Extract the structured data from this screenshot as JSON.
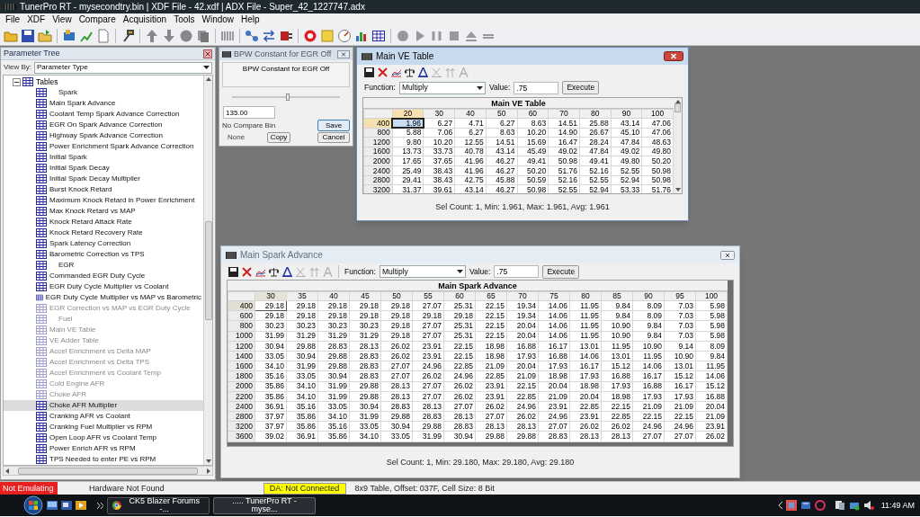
{
  "window": {
    "title": "TunerPro RT - mysecondtry.bin | XDF File - 42.xdf | ADX File - Super_42_1227747.adx"
  },
  "menu": [
    "File",
    "XDF",
    "View",
    "Compare",
    "Acquisition",
    "Tools",
    "Window",
    "Help"
  ],
  "parameter_tree": {
    "title": "Parameter Tree",
    "view_by_label": "View By:",
    "view_by": "Parameter Type",
    "root": {
      "label": "Tables",
      "expanded": true,
      "children": [
        {
          "label": "Spark",
          "kind": "heading",
          "disabled": false,
          "selected": false
        },
        {
          "label": "Main Spark Advance",
          "kind": "table",
          "disabled": false,
          "selected": false
        },
        {
          "label": "Coolant Temp Spark Advance Correction",
          "kind": "table",
          "disabled": false,
          "selected": false
        },
        {
          "label": "EGR On Spark Advance Correction",
          "kind": "table",
          "disabled": false,
          "selected": false
        },
        {
          "label": "Highway Spark Advance Correction",
          "kind": "table",
          "disabled": false,
          "selected": false
        },
        {
          "label": "Power Enrichment Spark Advance Correction",
          "kind": "table",
          "disabled": false,
          "selected": false
        },
        {
          "label": "Initial Spark",
          "kind": "table",
          "disabled": false,
          "selected": false
        },
        {
          "label": "Initial Spark Decay",
          "kind": "table",
          "disabled": false,
          "selected": false
        },
        {
          "label": "Initial Spark Decay Multiplier",
          "kind": "table",
          "disabled": false,
          "selected": false
        },
        {
          "label": "Burst Knock Retard",
          "kind": "table",
          "disabled": false,
          "selected": false
        },
        {
          "label": "Maximum Knock Retard in Power Enrichment",
          "kind": "table",
          "disabled": false,
          "selected": false
        },
        {
          "label": "Max Knock Retard vs MAP",
          "kind": "table",
          "disabled": false,
          "selected": false
        },
        {
          "label": "Knock Retard Attack Rate",
          "kind": "table",
          "disabled": false,
          "selected": false
        },
        {
          "label": "Knock Retard Recovery Rate",
          "kind": "table",
          "disabled": false,
          "selected": false
        },
        {
          "label": "Spark Latency Correction",
          "kind": "table",
          "disabled": false,
          "selected": false
        },
        {
          "label": "Barometric Correction vs TPS",
          "kind": "table",
          "disabled": false,
          "selected": false
        },
        {
          "label": "EGR",
          "kind": "heading",
          "disabled": false,
          "selected": false
        },
        {
          "label": "Commanded EGR Duty Cycle",
          "kind": "table",
          "disabled": false,
          "selected": false
        },
        {
          "label": "EGR Duty Cycle Multiplier vs Coolant",
          "kind": "table",
          "disabled": false,
          "selected": false
        },
        {
          "label": "EGR Duty Cycle Multiplier vs MAP vs Barometric",
          "kind": "table",
          "disabled": false,
          "selected": false
        },
        {
          "label": "EGR Correction vs MAP vs EGR Duty Cycle",
          "kind": "table",
          "disabled": true,
          "selected": false
        },
        {
          "label": "Fuel",
          "kind": "heading",
          "disabled": true,
          "selected": false
        },
        {
          "label": "Main VE Table",
          "kind": "table",
          "disabled": true,
          "selected": false
        },
        {
          "label": "VE Adder Table",
          "kind": "table",
          "disabled": true,
          "selected": false
        },
        {
          "label": "Accel Enrichment vs Delta MAP",
          "kind": "table",
          "disabled": true,
          "selected": false
        },
        {
          "label": "Accel Enrichment vs Delta TPS",
          "kind": "table",
          "disabled": true,
          "selected": false
        },
        {
          "label": "Accel Enrichment vs Coolant Temp",
          "kind": "table",
          "disabled": true,
          "selected": false
        },
        {
          "label": "Cold Engine AFR",
          "kind": "table",
          "disabled": true,
          "selected": false
        },
        {
          "label": "Choke AFR",
          "kind": "table",
          "disabled": true,
          "selected": false
        },
        {
          "label": "Choke AFR Multiplier",
          "kind": "table",
          "disabled": false,
          "selected": true
        },
        {
          "label": "Cranking AFR vs Coolant",
          "kind": "table",
          "disabled": false,
          "selected": false
        },
        {
          "label": "Cranking Fuel Multiplier vs RPM",
          "kind": "table",
          "disabled": false,
          "selected": false
        },
        {
          "label": "Open Loop AFR vs Coolant Temp",
          "kind": "table",
          "disabled": false,
          "selected": false
        },
        {
          "label": "Power Enrich AFR vs RPM",
          "kind": "table",
          "disabled": false,
          "selected": false
        },
        {
          "label": "TPS Needed to enter PE vs RPM",
          "kind": "table",
          "disabled": false,
          "selected": false
        }
      ]
    }
  },
  "constant_window": {
    "title": "BPW Constant for EGR Off",
    "description": "BPW Constant for EGR Off",
    "level": 0.52,
    "value": "135.00",
    "compare_label": "No Compare Bin",
    "save": "Save",
    "compare_value": "None",
    "copy": "Copy",
    "cancel": "Cancel"
  },
  "table_windows": [
    {
      "kind": "ve",
      "title": "Main VE Table",
      "active": true,
      "function_label": "Function:",
      "function": "Multiply",
      "value_label": "Value:",
      "value": ".75",
      "execute": "Execute",
      "table_title": "Main VE Table",
      "columns": [
        {
          "label": "20",
          "selected": true
        },
        {
          "label": "30",
          "selected": false
        },
        {
          "label": "40",
          "selected": false
        },
        {
          "label": "50",
          "selected": false
        },
        {
          "label": "60",
          "selected": false
        },
        {
          "label": "70",
          "selected": false
        },
        {
          "label": "80",
          "selected": false
        },
        {
          "label": "90",
          "selected": false
        },
        {
          "label": "100",
          "selected": false
        }
      ],
      "rows": [
        {
          "label": "400",
          "selected": true,
          "cells": [
            "1.96",
            "6.27",
            "4.71",
            "6.27",
            "8.63",
            "14.51",
            "25.88",
            "43.14",
            "47.06"
          ]
        },
        {
          "label": "800",
          "selected": false,
          "cells": [
            "5.88",
            "7.06",
            "6.27",
            "8.63",
            "10.20",
            "14.90",
            "26.67",
            "45.10",
            "47.06"
          ]
        },
        {
          "label": "1200",
          "selected": false,
          "cells": [
            "9.80",
            "10.20",
            "12.55",
            "14.51",
            "15.69",
            "16.47",
            "28.24",
            "47.84",
            "48.63"
          ]
        },
        {
          "label": "1600",
          "selected": false,
          "cells": [
            "13.73",
            "33.73",
            "40.78",
            "43.14",
            "45.49",
            "49.02",
            "47.84",
            "49.02",
            "49.80"
          ]
        },
        {
          "label": "2000",
          "selected": false,
          "cells": [
            "17.65",
            "37.65",
            "41.96",
            "46.27",
            "49.41",
            "50.98",
            "49.41",
            "49.80",
            "50.20"
          ]
        },
        {
          "label": "2400",
          "selected": false,
          "cells": [
            "25.49",
            "38.43",
            "41.96",
            "46.27",
            "50.20",
            "51.76",
            "52.16",
            "52.55",
            "50.98"
          ]
        },
        {
          "label": "2800",
          "selected": false,
          "cells": [
            "29.41",
            "38.43",
            "42.75",
            "45.88",
            "50.59",
            "52.16",
            "52.55",
            "52.94",
            "50.98"
          ]
        },
        {
          "label": "3200",
          "selected": false,
          "cells": [
            "31.37",
            "39.61",
            "43.14",
            "46.27",
            "50.98",
            "52.55",
            "52.94",
            "53.33",
            "51.76"
          ]
        }
      ],
      "status": "Sel Count: 1, Min: 1.961, Max: 1.961, Avg: 1.961"
    },
    {
      "kind": "spark",
      "title": "Main Spark Advance",
      "active": false,
      "function_label": "Function:",
      "function": "Multiply",
      "value_label": "Value:",
      "value": ".75",
      "execute": "Execute",
      "table_title": "Main Spark Advance",
      "columns": [
        {
          "label": "30",
          "selected": true
        },
        {
          "label": "35",
          "selected": false
        },
        {
          "label": "40",
          "selected": false
        },
        {
          "label": "45",
          "selected": false
        },
        {
          "label": "50",
          "selected": false
        },
        {
          "label": "55",
          "selected": false
        },
        {
          "label": "60",
          "selected": false
        },
        {
          "label": "65",
          "selected": false
        },
        {
          "label": "70",
          "selected": false
        },
        {
          "label": "75",
          "selected": false
        },
        {
          "label": "80",
          "selected": false
        },
        {
          "label": "85",
          "selected": false
        },
        {
          "label": "90",
          "selected": false
        },
        {
          "label": "95",
          "selected": false
        },
        {
          "label": "100",
          "selected": false
        }
      ],
      "rows": [
        {
          "label": "400",
          "selected": true,
          "cells": [
            "29.18",
            "29.18",
            "29.18",
            "29.18",
            "29.18",
            "27.07",
            "25.31",
            "22.15",
            "19.34",
            "14.06",
            "11.95",
            "9.84",
            "8.09",
            "7.03",
            "5.98"
          ]
        },
        {
          "label": "600",
          "selected": false,
          "cells": [
            "29.18",
            "29.18",
            "29.18",
            "29.18",
            "29.18",
            "29.18",
            "29.18",
            "22.15",
            "19.34",
            "14.06",
            "11.95",
            "9.84",
            "8.09",
            "7.03",
            "5.98"
          ]
        },
        {
          "label": "800",
          "selected": false,
          "cells": [
            "30.23",
            "30.23",
            "30.23",
            "30.23",
            "29.18",
            "27.07",
            "25.31",
            "22.15",
            "20.04",
            "14.06",
            "11.95",
            "10.90",
            "9.84",
            "7.03",
            "5.98"
          ]
        },
        {
          "label": "1000",
          "selected": false,
          "cells": [
            "31.99",
            "31.29",
            "31.29",
            "31.29",
            "29.18",
            "27.07",
            "25.31",
            "22.15",
            "20.04",
            "14.06",
            "11.95",
            "10.90",
            "9.84",
            "7.03",
            "5.98"
          ]
        },
        {
          "label": "1200",
          "selected": false,
          "cells": [
            "30.94",
            "29.88",
            "28.83",
            "28.13",
            "26.02",
            "23.91",
            "22.15",
            "18.98",
            "16.88",
            "16.17",
            "13.01",
            "11.95",
            "10.90",
            "9.14",
            "8.09"
          ]
        },
        {
          "label": "1400",
          "selected": false,
          "cells": [
            "33.05",
            "30.94",
            "29.88",
            "28.83",
            "26.02",
            "23.91",
            "22.15",
            "18.98",
            "17.93",
            "16.88",
            "14.06",
            "13.01",
            "11.95",
            "10.90",
            "9.84"
          ]
        },
        {
          "label": "1600",
          "selected": false,
          "cells": [
            "34.10",
            "31.99",
            "29.88",
            "28.83",
            "27.07",
            "24.96",
            "22.85",
            "21.09",
            "20.04",
            "17.93",
            "16.17",
            "15.12",
            "14.06",
            "13.01",
            "11.95"
          ]
        },
        {
          "label": "1800",
          "selected": false,
          "cells": [
            "35.16",
            "33.05",
            "30.94",
            "28.83",
            "27.07",
            "26.02",
            "24.96",
            "22.85",
            "21.09",
            "18.98",
            "17.93",
            "16.88",
            "16.17",
            "15.12",
            "14.06"
          ]
        },
        {
          "label": "2000",
          "selected": false,
          "cells": [
            "35.86",
            "34.10",
            "31.99",
            "29.88",
            "28.13",
            "27.07",
            "26.02",
            "23.91",
            "22.15",
            "20.04",
            "18.98",
            "17.93",
            "16.88",
            "16.17",
            "15.12"
          ]
        },
        {
          "label": "2200",
          "selected": false,
          "cells": [
            "35.86",
            "34.10",
            "31.99",
            "29.88",
            "28.13",
            "27.07",
            "26.02",
            "23.91",
            "22.85",
            "21.09",
            "20.04",
            "18.98",
            "17.93",
            "17.93",
            "16.88"
          ]
        },
        {
          "label": "2400",
          "selected": false,
          "cells": [
            "36.91",
            "35.16",
            "33.05",
            "30.94",
            "28.83",
            "28.13",
            "27.07",
            "26.02",
            "24.96",
            "23.91",
            "22.85",
            "22.15",
            "21.09",
            "21.09",
            "20.04"
          ]
        },
        {
          "label": "2800",
          "selected": false,
          "cells": [
            "37.97",
            "35.86",
            "34.10",
            "31.99",
            "29.88",
            "28.83",
            "28.13",
            "27.07",
            "26.02",
            "24.96",
            "23.91",
            "22.85",
            "22.15",
            "22.15",
            "21.09"
          ]
        },
        {
          "label": "3200",
          "selected": false,
          "cells": [
            "37.97",
            "35.86",
            "35.16",
            "33.05",
            "30.94",
            "29.88",
            "28.83",
            "28.13",
            "28.13",
            "27.07",
            "26.02",
            "26.02",
            "24.96",
            "24.96",
            "23.91"
          ]
        },
        {
          "label": "3600",
          "selected": false,
          "cells": [
            "39.02",
            "36.91",
            "35.86",
            "34.10",
            "33.05",
            "31.99",
            "30.94",
            "29.88",
            "29.88",
            "28.83",
            "28.13",
            "28.13",
            "27.07",
            "27.07",
            "26.02"
          ]
        }
      ],
      "status": "Sel Count: 1, Min: 29.180, Max: 29.180, Avg: 29.180"
    }
  ],
  "status_bar": [
    {
      "kind": "alert",
      "text": "Not Emulating"
    },
    {
      "kind": "plain",
      "text": "Hardware Not Found"
    },
    {
      "kind": "warning",
      "text": "DA: Not Connected"
    },
    {
      "kind": "plain",
      "text": "8x9 Table, Offset: 037F,  Cell Size: 8 Bit"
    }
  ],
  "taskbar": {
    "tasks": [
      {
        "label": "CK5 Blazer Forums -...",
        "kind": "browser",
        "selected": false
      },
      {
        "label": "..... TunerPro RT - myse...",
        "kind": "app",
        "selected": true
      }
    ],
    "clock": "11:49 AM"
  }
}
